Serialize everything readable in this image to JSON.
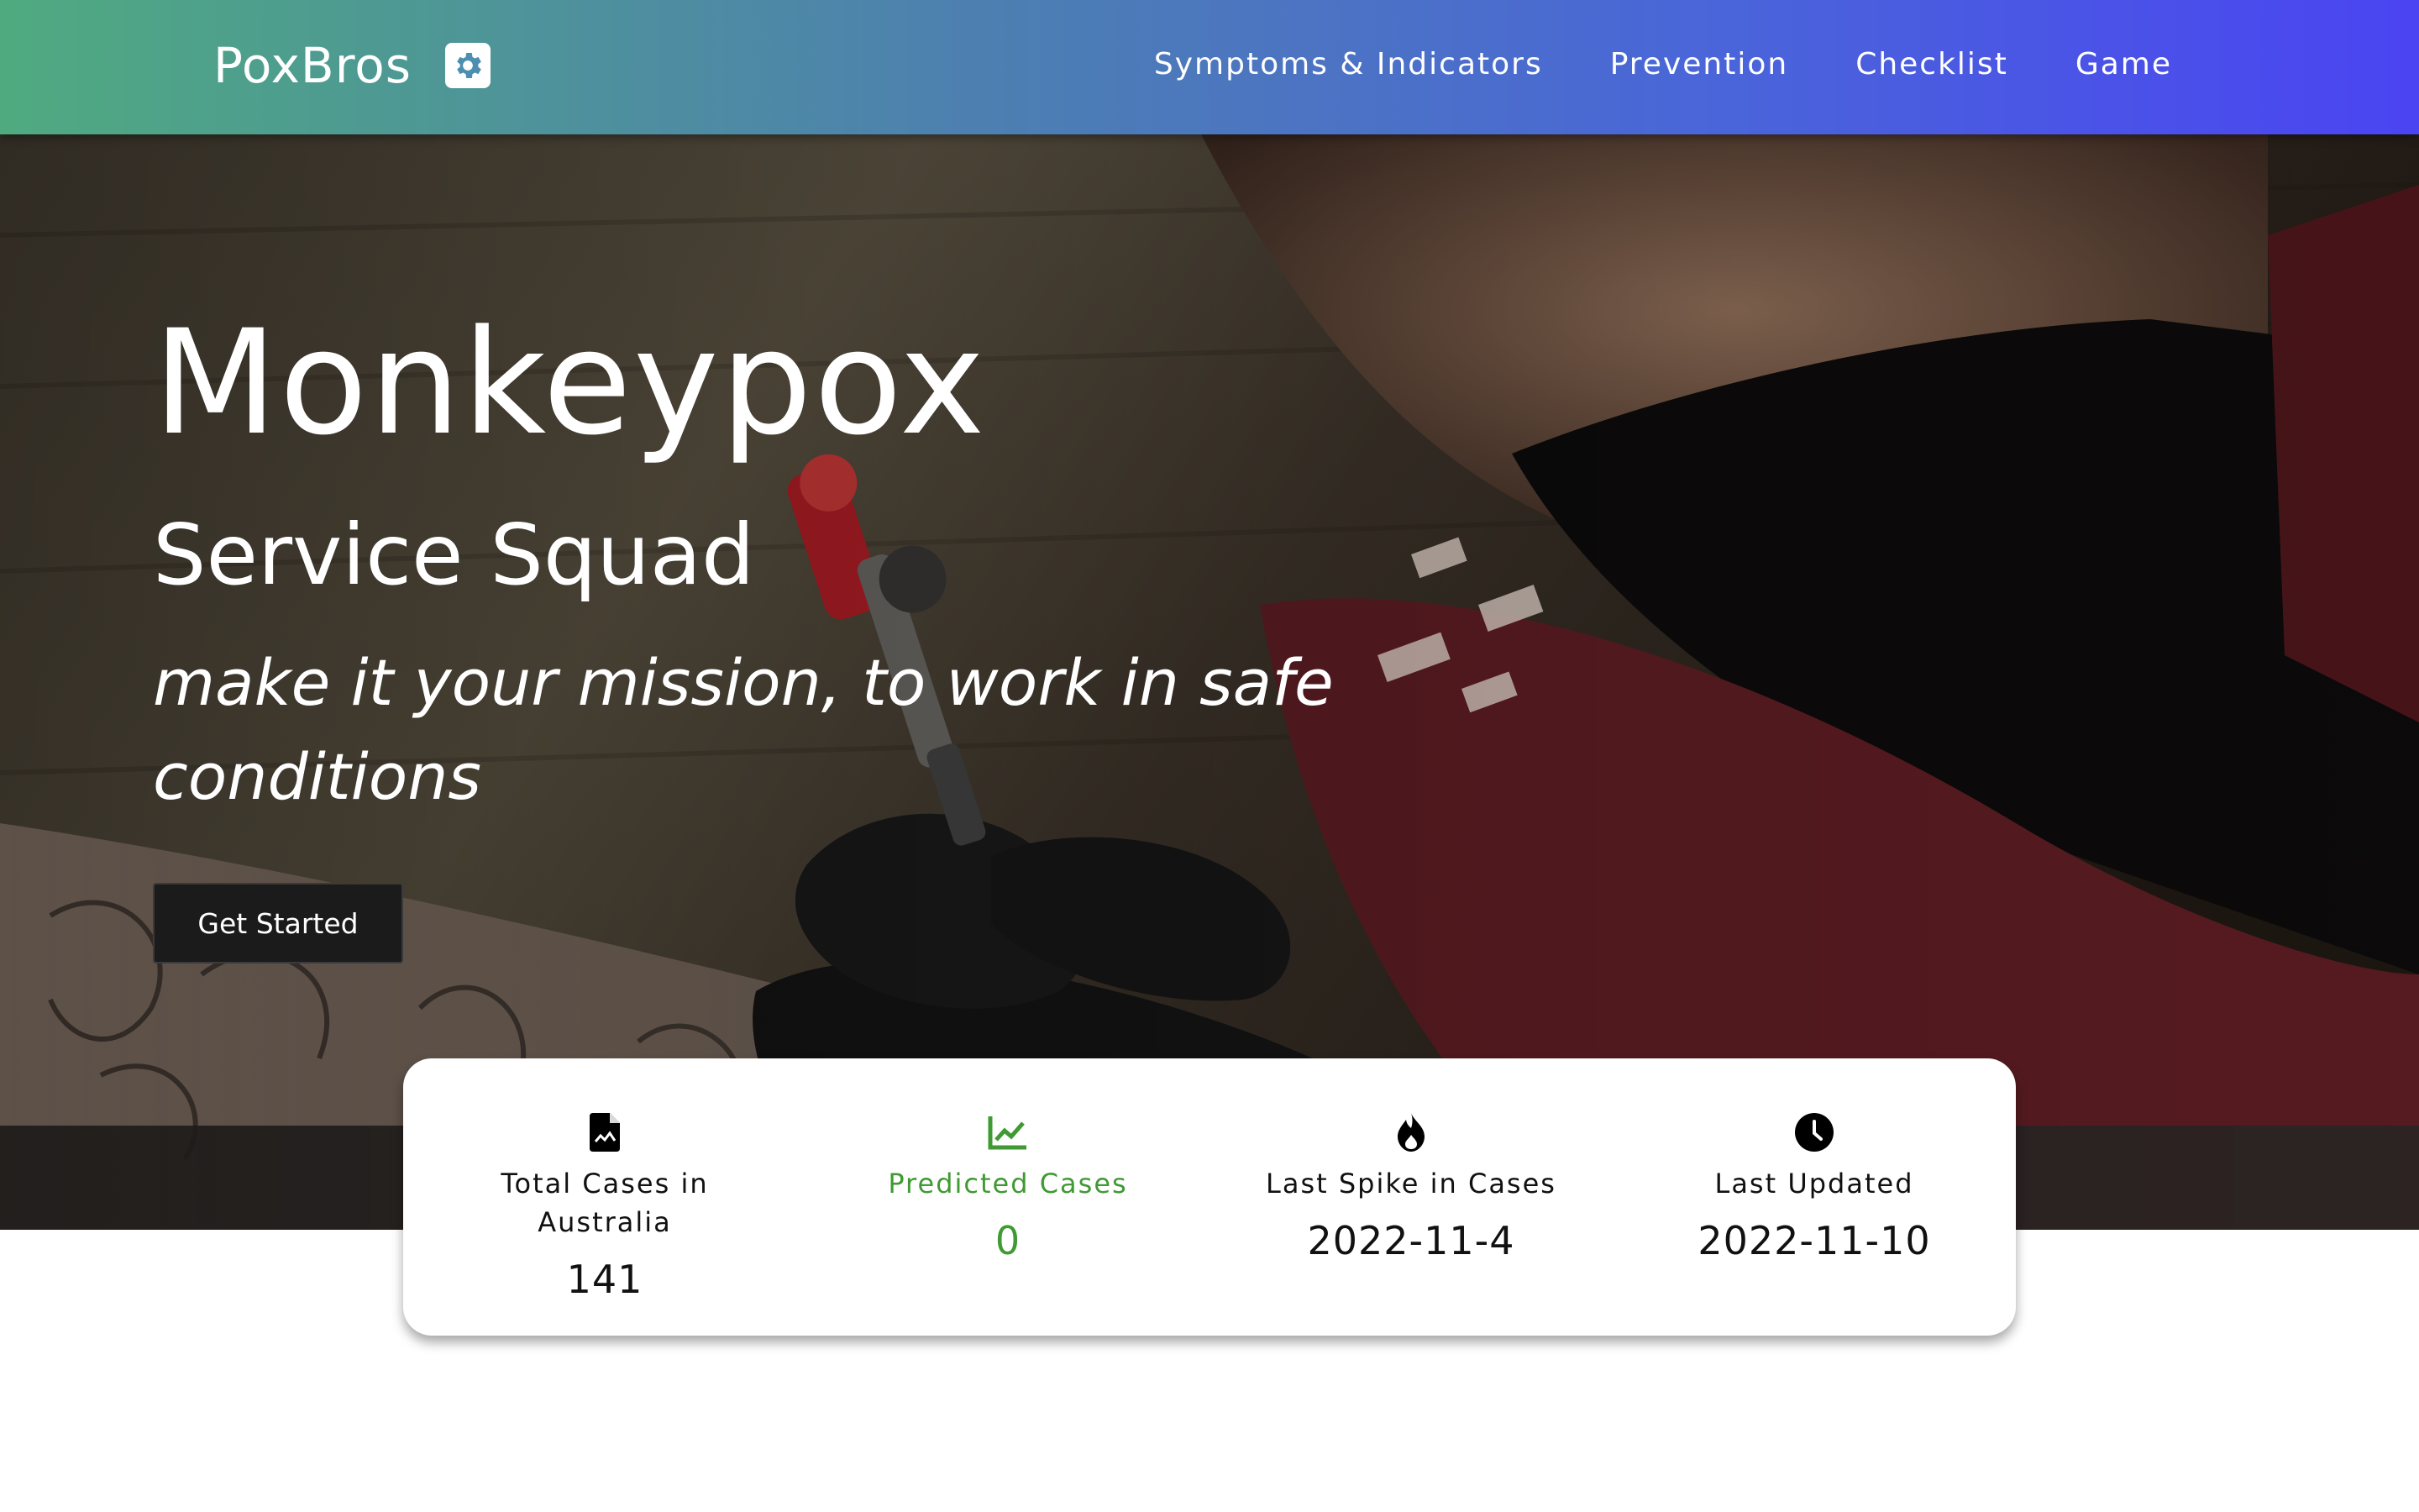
{
  "navbar": {
    "brand": "PoxBros",
    "brand_icon": "gear-icon",
    "links": [
      "Symptoms & Indicators",
      "Prevention",
      "Checklist",
      "Game"
    ]
  },
  "hero": {
    "title": "Monkeypox",
    "subtitle": "Service Squad",
    "tagline": "make it your mission, to work in safe conditions",
    "cta_label": "Get Started"
  },
  "stats": [
    {
      "icon": "file-document-icon",
      "label": "Total Cases in Australia",
      "value": "141",
      "accent": "#111111"
    },
    {
      "icon": "chart-line-icon",
      "label": "Predicted Cases",
      "value": "0",
      "accent": "#3f9a33"
    },
    {
      "icon": "fire-icon",
      "label": "Last Spike in Cases",
      "value": "2022-11-4",
      "accent": "#111111"
    },
    {
      "icon": "clock-icon",
      "label": "Last Updated",
      "value": "2022-11-10",
      "accent": "#111111"
    }
  ],
  "colors": {
    "navbar_gradient_start": "#4faa80",
    "navbar_gradient_end": "#4a44f2",
    "predicted_accent": "#3f9a33",
    "cta_background": "#1b1b1b"
  }
}
